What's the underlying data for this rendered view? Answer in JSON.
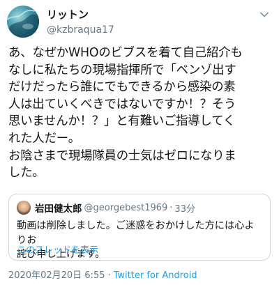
{
  "author": {
    "display_name": "リットン",
    "handle": "@kzbraqua17"
  },
  "tweet": {
    "text": "あ、なぜかWHOのビブスを着て自己紹介も\nなしに私たちの現場指揮所で「ベンゾ出す\nだけだったら誰にでもできるから感染の素\n人は出ていくべきではないですか！？そう\n思いませんか！？」と有難いご指導してく\nれた人だー。\nお陰さまで現場隊員の士気はゼロになりま\nした。"
  },
  "quoted": {
    "display_name": "岩田健太郎",
    "handle": "@georgebest1969",
    "dot": "·",
    "time": "33分",
    "text": "動画は削除しました。ご迷惑をおかけした方には心よりお\n詫び申し上げます。",
    "thread_link": "このスレッドを表示"
  },
  "meta": {
    "timestamp": "2020年02月20日 6:55",
    "dot": "·",
    "source": "Twitter for Android"
  },
  "icons": {
    "menu": "chevron-down-icon",
    "avatar": "avatar",
    "quote_avatar": "avatar"
  }
}
